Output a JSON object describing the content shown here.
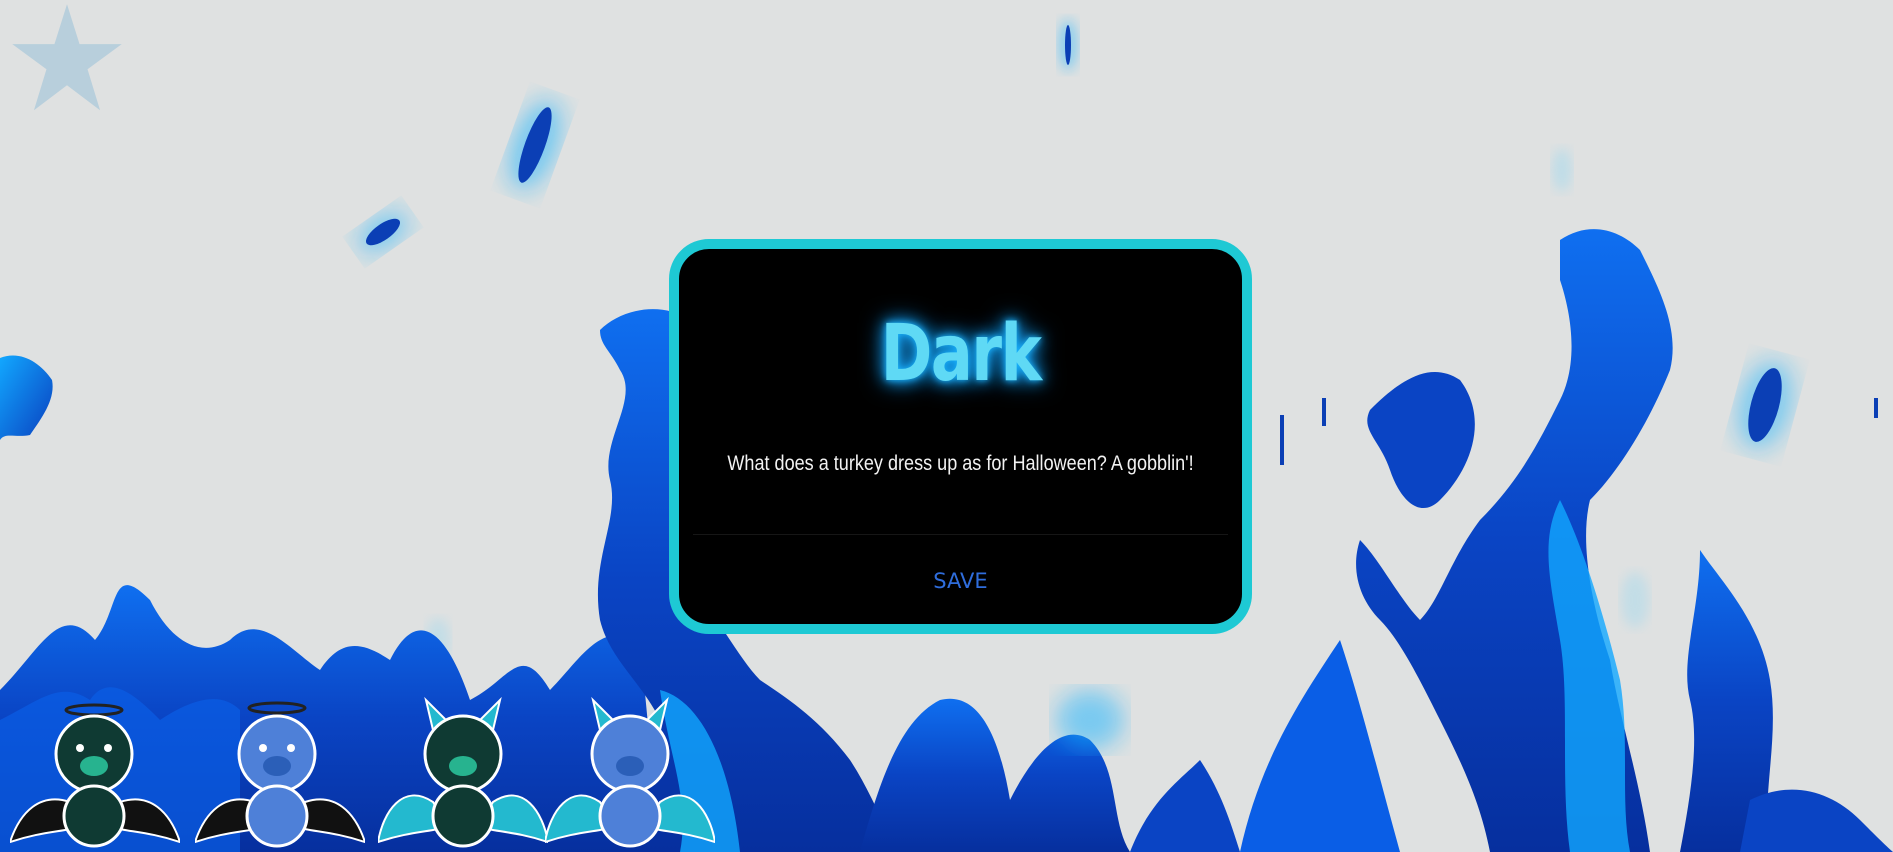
{
  "modal": {
    "title": "Dark",
    "message": "What does a turkey dress up as for Halloween? A gobblin'!",
    "save_label": "SAVE"
  },
  "colors": {
    "background": "#dfe1e1",
    "modal_border": "#1ec9d4",
    "title_glow": "#19b6ff",
    "title_text": "#5fd9f5",
    "save_button": "#2f6ddc",
    "flame_dark": "#0a3fbf",
    "flame_light": "#0fa3ff"
  },
  "icons": {
    "star": "star-icon",
    "characters": [
      "angel-pig-character",
      "angel-bear-character",
      "devil-pig-character",
      "devil-bear-character"
    ]
  }
}
